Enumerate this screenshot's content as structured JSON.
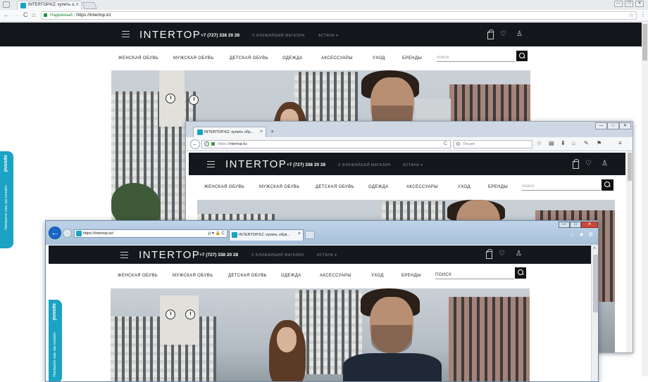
{
  "chrome": {
    "tab_title": "INTERTOP.KZ: купить о...",
    "tab_close": "×",
    "secure_label": "Надежный",
    "url": "https://intertop.kz",
    "back_glyph": "←",
    "forward_glyph": "→",
    "reload_glyph": "C",
    "home_glyph": "⌂",
    "star_glyph": "☆",
    "menu_glyph": "⋮",
    "win_min": "—",
    "win_max": "❐",
    "win_close": "✕"
  },
  "firefox": {
    "tab_title": "INTERTOP.KZ: купить обу...",
    "tab_close": "×",
    "new_tab": "+",
    "url_prefix": "https://",
    "url_domain": "intertop.kz",
    "search_placeholder": "Пошук",
    "reload_glyph": "C",
    "back_glyph": "←",
    "win_min": "—",
    "win_max": "□",
    "win_close": "✕",
    "toolbar_icons": [
      "☆",
      "▤",
      "⬇",
      "⌂",
      "✎",
      "⚑",
      "≡"
    ]
  },
  "ie": {
    "url": "https://intertop.kz/",
    "url_controls": "ρ ▾ 🔒 C",
    "tab_title": "INTERTOP.KZ: купить обув...",
    "tab_close": "×",
    "back_glyph": "←",
    "forward_glyph": "→",
    "win_min": "—",
    "win_max": "□",
    "win_close": "✕",
    "toolbar_icons": [
      "⌂",
      "★",
      "⚙"
    ],
    "scroll_up": "˄"
  },
  "site": {
    "logo": "INTERTOP",
    "phone": "+7 (727) 338 20 28",
    "store_link": "БЛИЖАЙШИЙ МАГАЗИН",
    "city": "АСТАНА ▾",
    "store_pin": "⚲",
    "heart": "♡",
    "user": "♙",
    "nav": [
      "ЖЕНСКАЯ ОБУВЬ",
      "МУЖСКАЯ ОБУВЬ",
      "ДЕТСКАЯ ОБУВЬ",
      "ОДЕЖДА",
      "АКСЕССУАРЫ",
      "УХОД",
      "БРЕНДЫ"
    ],
    "search_placeholder_lower": "поиск",
    "search_placeholder_upper": "ПОИСК"
  },
  "jivo": {
    "brand": "jivosite",
    "cta": "Напишите нам, мы онлайн!"
  },
  "icons": {
    "back": "arrow-left-icon",
    "reload": "reload-icon",
    "star": "star-icon",
    "lock": "lock-icon",
    "search": "search-icon",
    "cart": "shopping-bag-icon",
    "heart": "heart-icon",
    "user": "user-icon",
    "menu": "hamburger-icon"
  },
  "colors": {
    "site_header": "#14171c",
    "accent": "#1aa3c2",
    "secure_green": "#1e8e3e",
    "ie_back": "#1a67c7"
  }
}
